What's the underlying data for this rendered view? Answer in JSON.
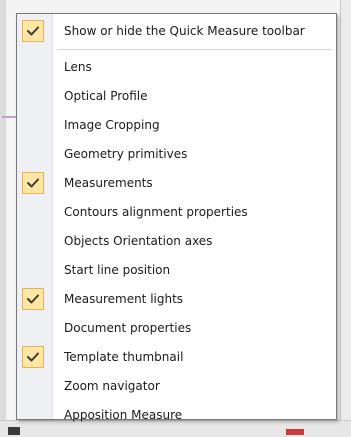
{
  "menu": {
    "items": [
      {
        "label": "Show or hide the Quick Measure toolbar",
        "checked": true
      },
      {
        "label": "Lens",
        "checked": false
      },
      {
        "label": "Optical Profile",
        "checked": false
      },
      {
        "label": "Image Cropping",
        "checked": false
      },
      {
        "label": "Geometry primitives",
        "checked": false
      },
      {
        "label": "Measurements",
        "checked": true
      },
      {
        "label": "Contours alignment properties",
        "checked": false
      },
      {
        "label": "Objects Orientation axes",
        "checked": false
      },
      {
        "label": "Start line position",
        "checked": false
      },
      {
        "label": "Measurement lights",
        "checked": true
      },
      {
        "label": "Document properties",
        "checked": false
      },
      {
        "label": "Template thumbnail",
        "checked": true
      },
      {
        "label": "Zoom navigator",
        "checked": false
      },
      {
        "label": "Apposition Measure",
        "checked": false
      }
    ]
  },
  "colors": {
    "check_fill": "#ffe6a2",
    "check_border": "#e0b45c",
    "gutter": "#eef0f3"
  },
  "icons": {
    "check": "checkmark-icon"
  }
}
